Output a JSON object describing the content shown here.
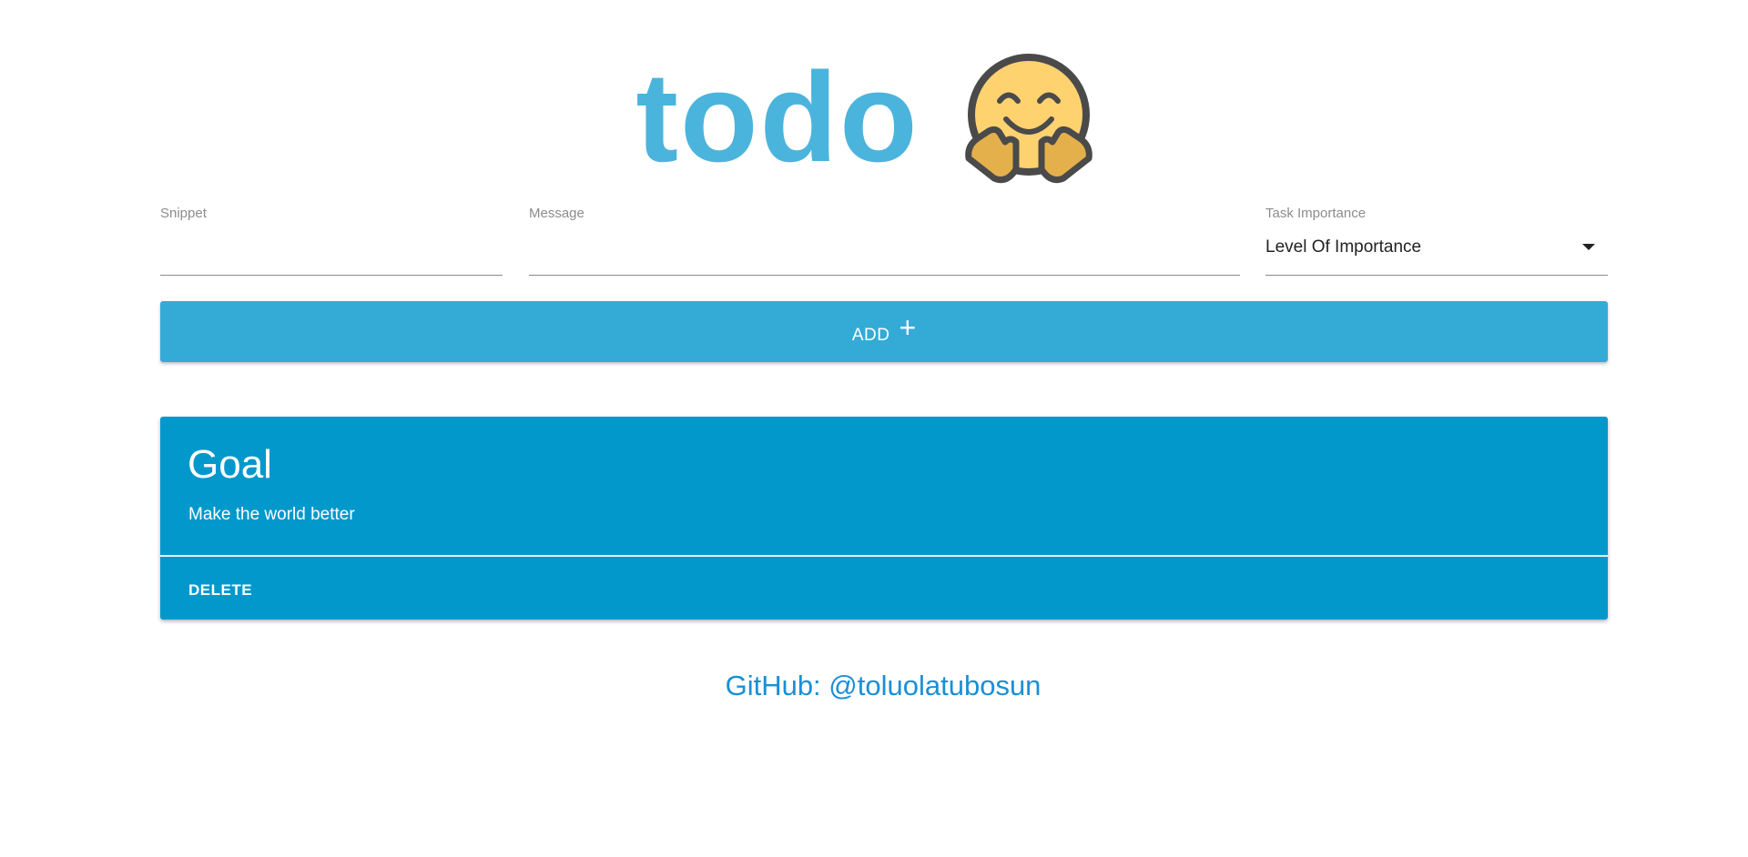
{
  "header": {
    "title": "todo",
    "emoji_icon": "hugging-face-icon"
  },
  "form": {
    "snippet": {
      "label": "Snippet",
      "value": "",
      "placeholder": ""
    },
    "message": {
      "label": "Message",
      "value": "",
      "placeholder": ""
    },
    "importance": {
      "label": "Task Importance",
      "selected": "Level Of Importance"
    },
    "add_label": "ADD",
    "add_icon": "+"
  },
  "todos": [
    {
      "title": "Goal",
      "message": "Make the world better",
      "delete_label": "DELETE"
    }
  ],
  "footer": {
    "github_text": "GitHub: @toluolatubosun"
  },
  "colors": {
    "logo": "#4bb4dc",
    "add_button": "#34abd6",
    "card": "#0298cc",
    "footer_link": "#1a8fd6"
  }
}
